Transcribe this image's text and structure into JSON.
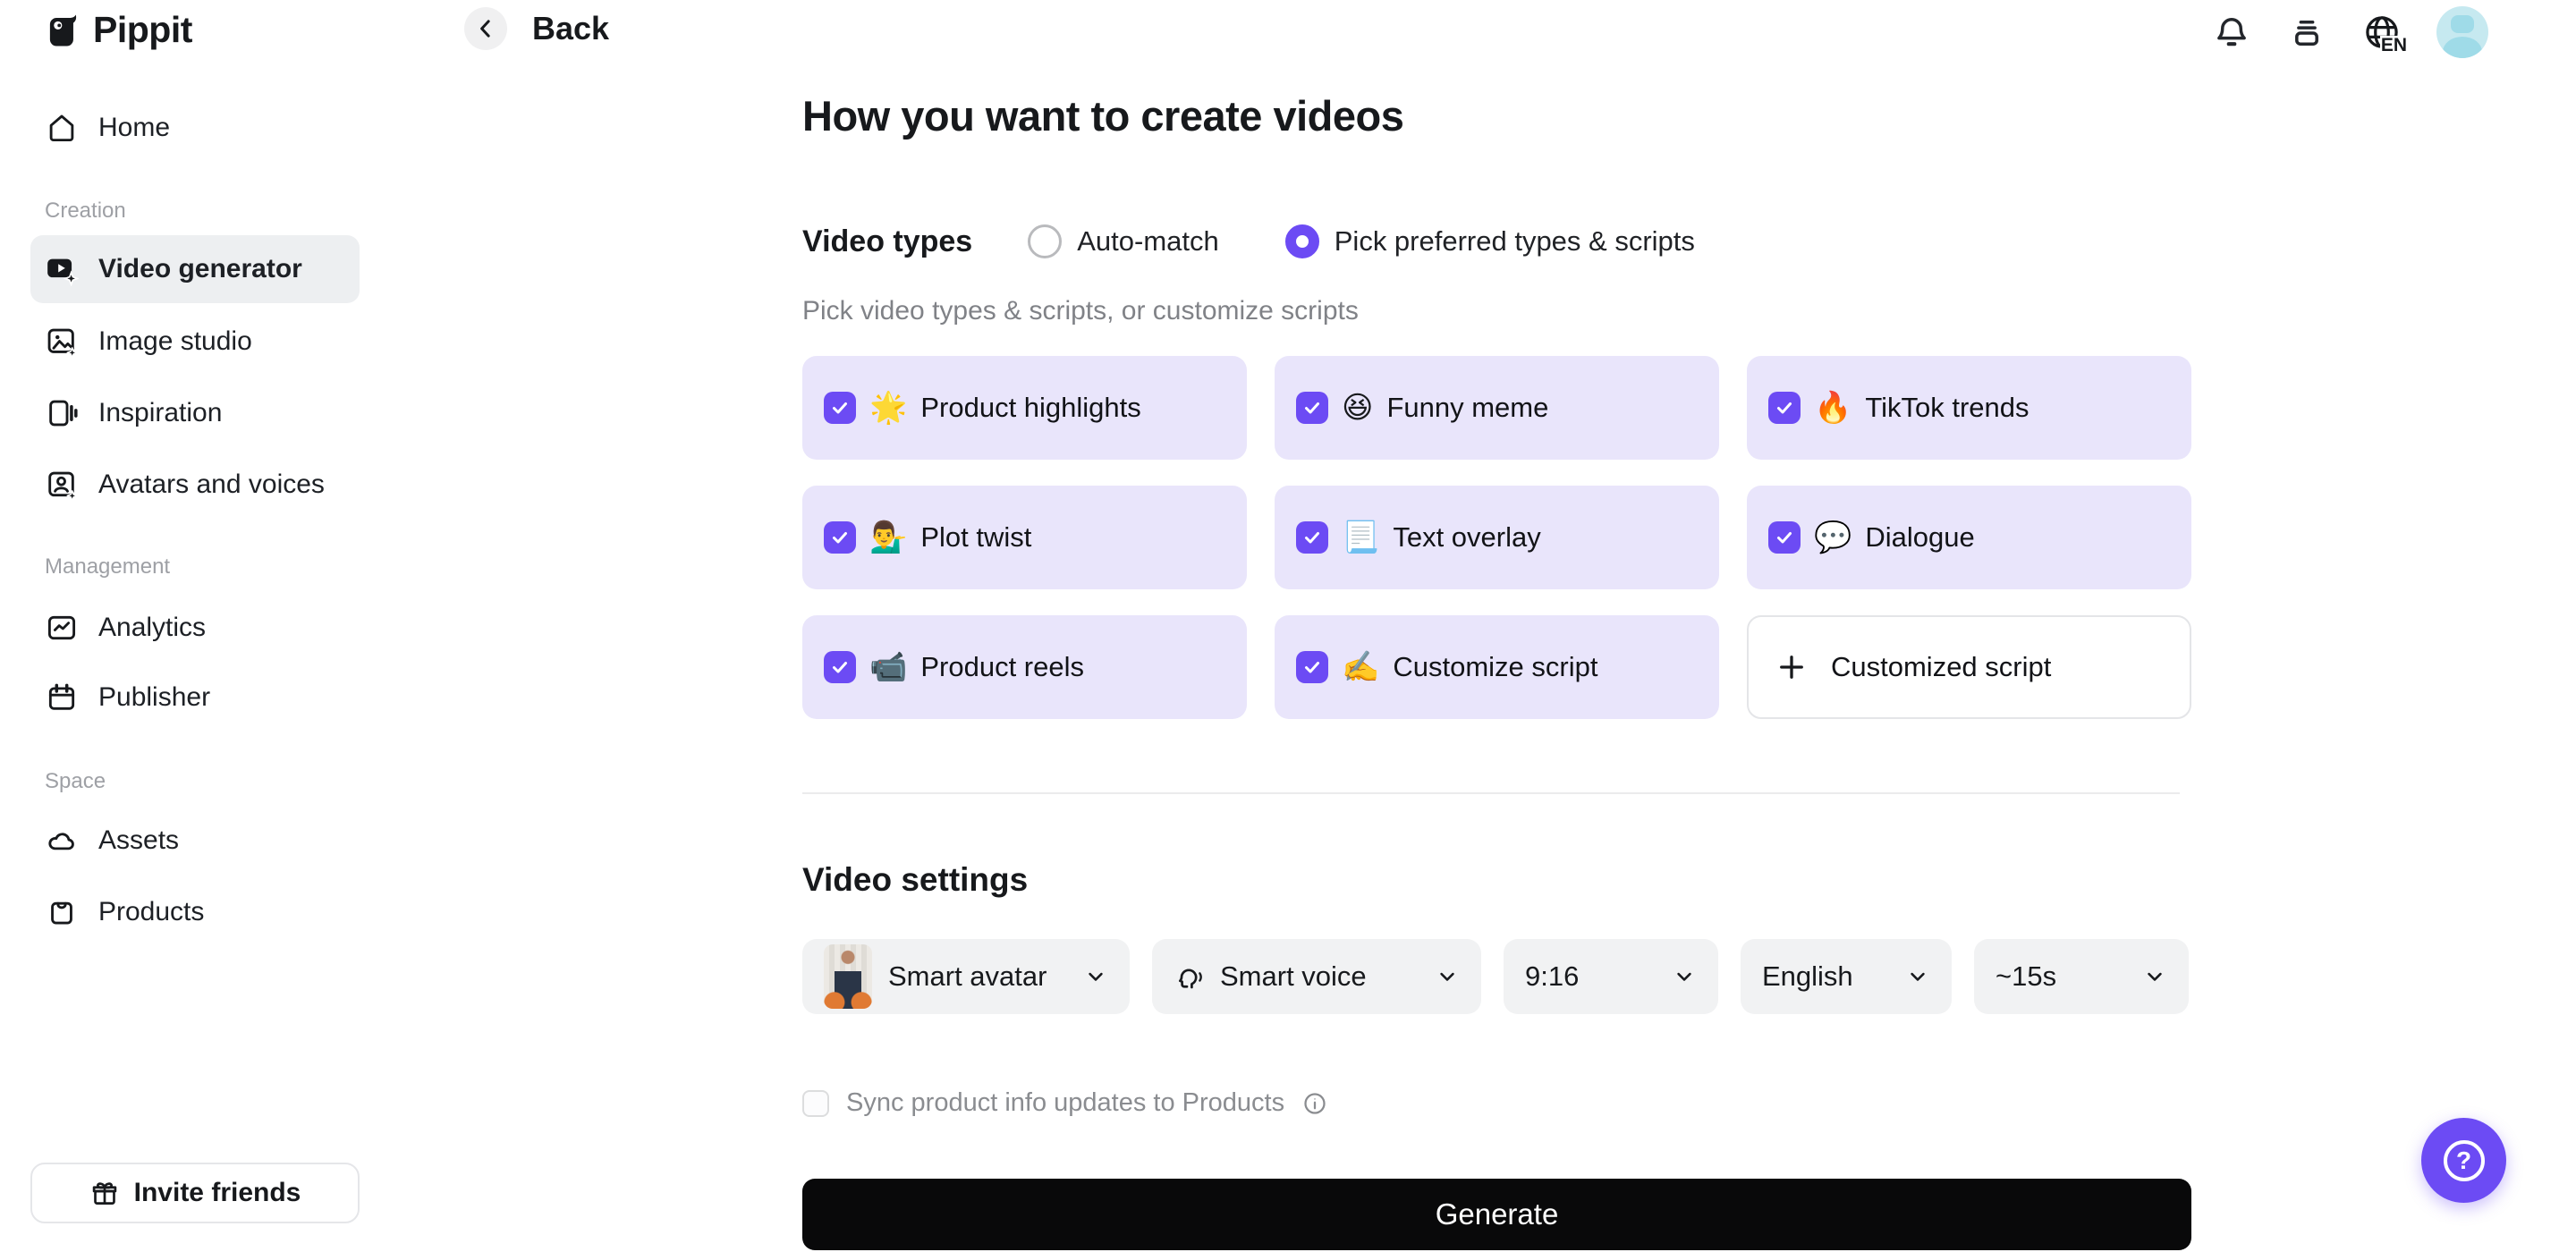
{
  "sidebar": {
    "brand": "Pippit",
    "home": "Home",
    "sections": [
      {
        "label": "Creation",
        "items": [
          "Video generator",
          "Image studio",
          "Inspiration",
          "Avatars and voices"
        ]
      },
      {
        "label": "Management",
        "items": [
          "Analytics",
          "Publisher"
        ]
      },
      {
        "label": "Space",
        "items": [
          "Assets",
          "Products"
        ]
      }
    ],
    "active_item": "Video generator",
    "invite_label": "Invite friends"
  },
  "topbar": {
    "back_label": "Back",
    "language_code": "EN"
  },
  "main": {
    "title": "How you want to create videos"
  },
  "video_types": {
    "section_label": "Video types",
    "options": [
      {
        "label": "Auto-match",
        "selected": false
      },
      {
        "label": "Pick preferred types & scripts",
        "selected": true
      }
    ],
    "hint": "Pick video types & scripts, or customize scripts",
    "cards": [
      {
        "emoji": "🌟",
        "label": "Product highlights",
        "checked": true
      },
      {
        "emoji": "😆",
        "label": "Funny meme",
        "checked": true
      },
      {
        "emoji": "🔥",
        "label": "TikTok trends",
        "checked": true
      },
      {
        "emoji": "💁‍♂️",
        "label": "Plot twist",
        "checked": true
      },
      {
        "emoji": "📃",
        "label": "Text overlay",
        "checked": true
      },
      {
        "emoji": "💬",
        "label": "Dialogue",
        "checked": true
      },
      {
        "emoji": "📹",
        "label": "Product reels",
        "checked": true
      },
      {
        "emoji": "✍️",
        "label": "Customize script",
        "checked": true
      }
    ],
    "add_card_label": "Customized script"
  },
  "video_settings": {
    "title": "Video settings",
    "dropdowns": [
      {
        "label": "Smart avatar"
      },
      {
        "label": "Smart voice"
      },
      {
        "label": "9:16"
      },
      {
        "label": "English"
      },
      {
        "label": "~15s"
      }
    ],
    "sync_label": "Sync product info updates to Products",
    "sync_checked": false
  },
  "generate_label": "Generate",
  "colors": {
    "accent": "#6c4bf4",
    "card_bg": "#e9e5fb",
    "generate_bg": "#09090a"
  },
  "icons": {
    "back": "chevron-left",
    "notifications": "bell",
    "inbox": "tray",
    "language": "globe",
    "add": "plus",
    "info": "circled-i",
    "help": "question-mark",
    "invite": "gift"
  }
}
